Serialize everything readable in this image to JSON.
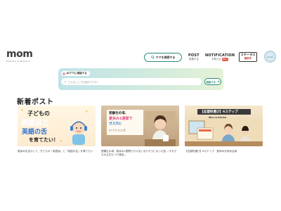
{
  "header": {
    "logo_text": "mom",
    "logo_sub": "Mobilize of Mothers",
    "search_button": "ママを検索する",
    "nav": [
      {
        "title": "POST",
        "sub": "投稿する"
      },
      {
        "title": "NOTIFICATION",
        "sub": "お知らせ",
        "badge": "99+"
      }
    ],
    "status": {
      "title": "ステータス",
      "sub": "無料中"
    },
    "avatar_text": "mom"
  },
  "banner": {
    "tag_label": "AIママに相談する",
    "placeholder": "どんなことでお悩みですか？",
    "send_label": "相談する"
  },
  "section_title": "新着ポスト",
  "cards": [
    {
      "thumb": {
        "line1": "子どもの",
        "line2": "英語耳と",
        "line3": "英語の舌",
        "line4": "を育てたい！"
      },
      "caption": "夏休みを活かして、子どもの「英語耳」と「英語の舌」を育てたい"
    },
    {
      "thumb": {
        "p1": "受験生の母、",
        "p2": "夏休み1週間で",
        "p3": "ガス欠に",
        "p4": "なりそうになった話"
      },
      "caption": "受験生の母、夏休み1週間でガス欠になりそうになった話 ―それでも大丈夫だった理由―"
    },
    {
      "thumb": {
        "title": "【志望校選び】6ステップ",
        "sub": "夏休みを有効活用"
      },
      "caption": "【志望校選び】6ステップ　夏休みを有効活用"
    }
  ]
}
